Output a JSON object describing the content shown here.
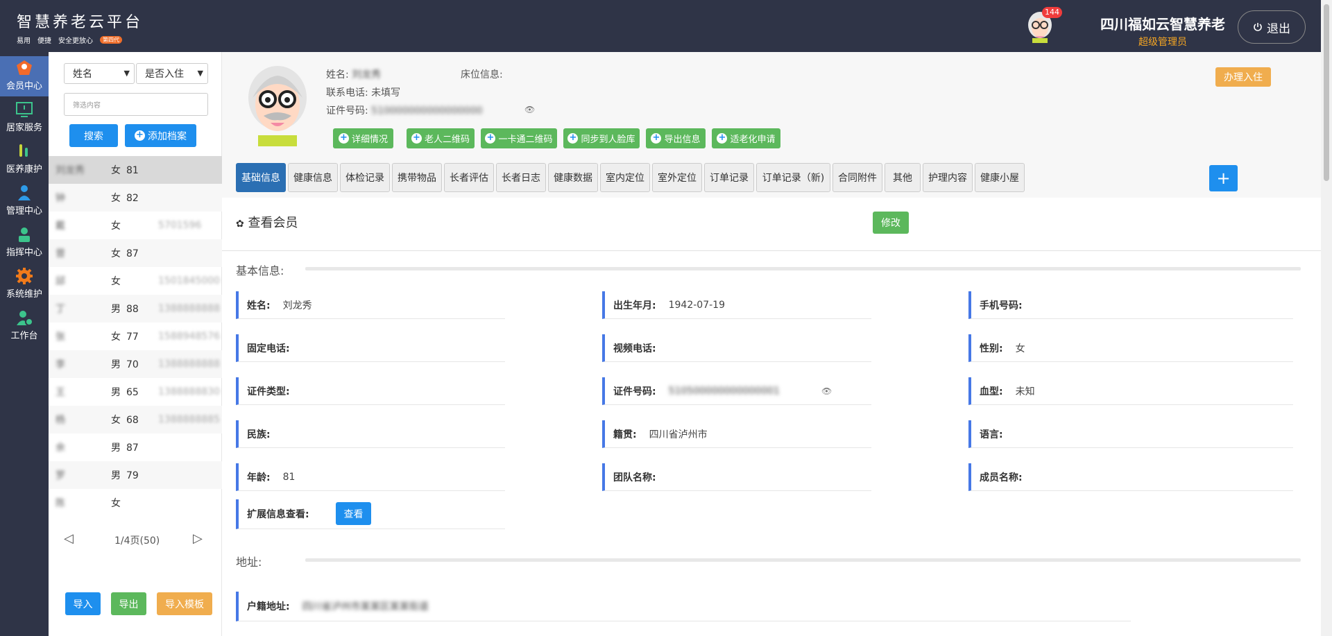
{
  "app": {
    "title": "智慧养老云平台",
    "tags": [
      "易用",
      "便捷",
      "安全更放心"
    ],
    "tag_badge": "第四代"
  },
  "header": {
    "notification_count": "144",
    "org_name": "四川福如云智慧养老",
    "role": "超级管理员",
    "logout_label": "退出"
  },
  "sidebar": {
    "items": [
      {
        "label": "会员中心",
        "icon": "member-icon"
      },
      {
        "label": "居家服务",
        "icon": "home-service-icon"
      },
      {
        "label": "医养康护",
        "icon": "medical-icon"
      },
      {
        "label": "管理中心",
        "icon": "management-icon"
      },
      {
        "label": "指挥中心",
        "icon": "command-icon"
      },
      {
        "label": "系统维护",
        "icon": "gear-icon"
      },
      {
        "label": "工作台",
        "icon": "workbench-icon"
      }
    ]
  },
  "list": {
    "select_field": "姓名",
    "select_checkin": "是否入住",
    "filter_placeholder": "筛选内容",
    "search_label": "搜索",
    "add_label": "添加档案",
    "members": [
      {
        "name": "刘龙秀",
        "gender": "女",
        "age": "81",
        "phone": ""
      },
      {
        "name": "钟",
        "gender": "女",
        "age": "82",
        "phone": ""
      },
      {
        "name": "戴",
        "gender": "女",
        "age": "",
        "phone": "5701596"
      },
      {
        "name": "曾",
        "gender": "女",
        "age": "87",
        "phone": ""
      },
      {
        "name": "邱",
        "gender": "女",
        "age": "",
        "phone": "1501845000"
      },
      {
        "name": "丁",
        "gender": "男",
        "age": "88",
        "phone": "1388888888"
      },
      {
        "name": "张",
        "gender": "女",
        "age": "77",
        "phone": "1588948576"
      },
      {
        "name": "李",
        "gender": "男",
        "age": "70",
        "phone": "1388888888"
      },
      {
        "name": "王",
        "gender": "男",
        "age": "65",
        "phone": "1388888830"
      },
      {
        "name": "杨",
        "gender": "女",
        "age": "68",
        "phone": "1388888885"
      },
      {
        "name": "余",
        "gender": "男",
        "age": "87",
        "phone": ""
      },
      {
        "name": "罗",
        "gender": "男",
        "age": "79",
        "phone": ""
      },
      {
        "name": "陈",
        "gender": "女",
        "age": "",
        "phone": ""
      }
    ],
    "page_info": "1/4页(50)",
    "import_label": "导入",
    "export_label": "导出",
    "template_label": "导入模板"
  },
  "profile": {
    "name_label": "姓名:",
    "name_value": "刘龙秀",
    "bed_label": "床位信息:",
    "phone_label": "联系电话:",
    "phone_value": "未填写",
    "id_label": "证件号码:",
    "id_value": "510000000000000000",
    "checkin_label": "办理入住",
    "actions": [
      "详细情况",
      "老人二维码",
      "一卡通二维码",
      "同步到人脸库",
      "导出信息",
      "适老化申请"
    ]
  },
  "tabs": [
    "基础信息",
    "健康信息",
    "体检记录",
    "携带物品",
    "长者评估",
    "长者日志",
    "健康数据",
    "室内定位",
    "室外定位",
    "订单记录",
    "订单记录（新)",
    "合同附件",
    "其他",
    "护理内容",
    "健康小屋"
  ],
  "view": {
    "title": "查看会员",
    "edit_label": "修改",
    "basic_section": "基本信息:",
    "address_section": "地址:",
    "fields": {
      "name_l": "姓名:",
      "name_v": "刘龙秀",
      "birth_l": "出生年月:",
      "birth_v": "1942-07-19",
      "mobile_l": "手机号码:",
      "landline_l": "固定电话:",
      "video_l": "视频电话:",
      "gender_l": "性别:",
      "gender_v": "女",
      "idtype_l": "证件类型:",
      "idno_l": "证件号码:",
      "idno_v": "510500000000000001",
      "blood_l": "血型:",
      "blood_v": "未知",
      "ethnic_l": "民族:",
      "native_l": "籍贯:",
      "native_v": "四川省泸州市",
      "lang_l": "语言:",
      "age_l": "年龄:",
      "age_v": "81",
      "team_l": "团队名称:",
      "memberName_l": "成员名称:",
      "ext_l": "扩展信息查看:",
      "ext_btn": "查看",
      "huji_l": "户籍地址:",
      "huji_v": "四川省泸州市某某区某某街道"
    }
  },
  "colors": {
    "accent": "#1e8fee",
    "nav_bg": "#2f3447",
    "green": "#5cb85c",
    "orange": "#f0ad4e",
    "field_border": "#4678e6"
  }
}
